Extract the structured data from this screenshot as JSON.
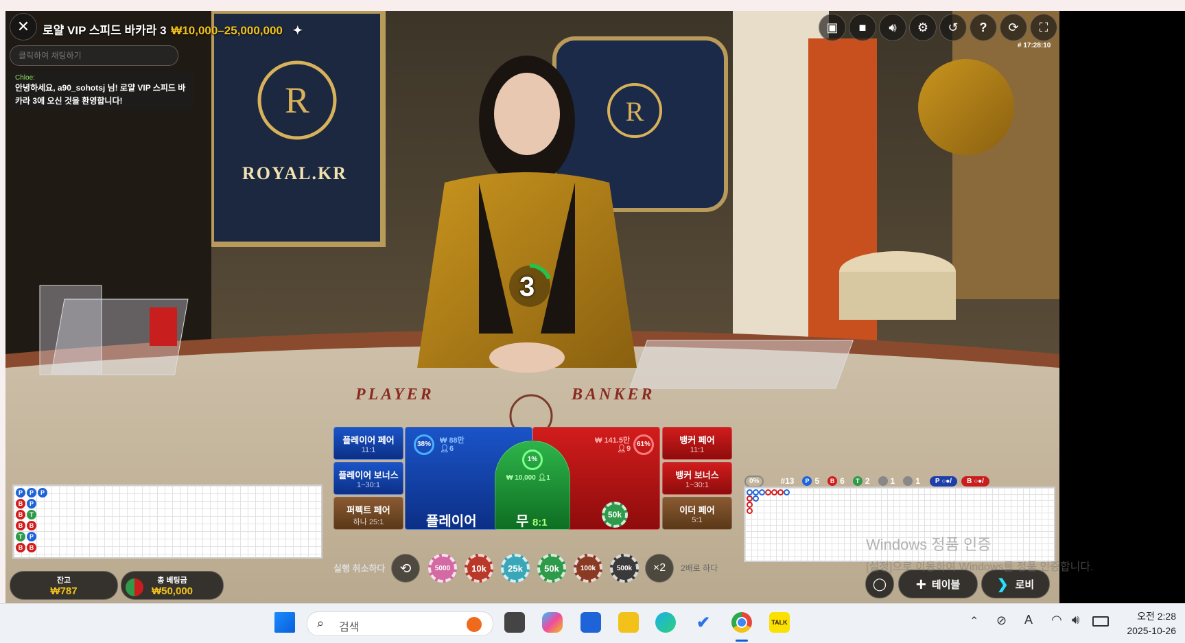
{
  "window": {
    "title": "로얄 VIP 스피드 바카라 3",
    "limits": "₩10,000–25,000,000",
    "round_time": "# 17:28:10"
  },
  "chat": {
    "placeholder": "클릭하여 채팅하기",
    "author": "Chloe:",
    "message": "안녕하세요, a90_sohotsj 님! 로얄 VIP 스피드 바카라 3에 오신 것을 환영합니다!"
  },
  "scene": {
    "sign": "ROYAL.KR",
    "player_label": "PLAYER",
    "banker_label": "BANKER",
    "countdown": "3"
  },
  "toolbar_icons": [
    "chat-icon",
    "video-icon",
    "sound-icon",
    "settings-icon",
    "history-icon",
    "help-icon",
    "refresh-icon",
    "fullscreen-icon"
  ],
  "side_bets": {
    "player_pair": {
      "label": "플레이어 페어",
      "odds": "11:1"
    },
    "player_bonus": {
      "label": "플레이어 보너스",
      "odds": "1~30:1"
    },
    "perfect_pair": {
      "label": "퍼펙트 페어",
      "odds": "하나 25:1"
    },
    "banker_pair": {
      "label": "뱅커 페어",
      "odds": "11:1"
    },
    "banker_bonus": {
      "label": "뱅커 보너스",
      "odds": "1~30:1"
    },
    "either_pair": {
      "label": "이더 페어",
      "odds": "5:1"
    }
  },
  "main_bets": {
    "player": {
      "label": "플레이어",
      "percent": "38%",
      "amount": "₩ 88만",
      "players": "6"
    },
    "tie": {
      "label": "무",
      "odds": "8:1",
      "percent": "1%",
      "amount": "₩ 10,000",
      "players": "1"
    },
    "banker": {
      "label": "",
      "percent": "61%",
      "amount": "₩ 141.5만",
      "players": "9",
      "chip": "50k"
    }
  },
  "chips": {
    "undo_label": "실행 취소하다",
    "items": [
      {
        "label": "5000",
        "color": "#d46aa4"
      },
      {
        "label": "10k",
        "color": "#b8382a"
      },
      {
        "label": "25k",
        "color": "#3aa7b8"
      },
      {
        "label": "50k",
        "color": "#2e9a4a"
      },
      {
        "label": "100k",
        "color": "#8a3a22"
      },
      {
        "label": "500k",
        "color": "#3a3a3a"
      }
    ],
    "double_label": "×2",
    "double_text": "2배로 하다"
  },
  "balance": {
    "label": "잔고",
    "value": "₩787"
  },
  "total_bet": {
    "label": "총 베팅금",
    "value": "₩50,000"
  },
  "stats": {
    "percent": "0%",
    "round": "#13",
    "player": "5",
    "banker": "6",
    "tie": "2",
    "player_pair": "1",
    "banker_pair": "1",
    "p_letter": "P",
    "b_letter": "B",
    "t_letter": "T"
  },
  "bead_road": [
    {
      "col": 0,
      "row": 0,
      "v": "P"
    },
    {
      "col": 1,
      "row": 0,
      "v": "P"
    },
    {
      "col": 2,
      "row": 0,
      "v": "P"
    },
    {
      "col": 0,
      "row": 1,
      "v": "B"
    },
    {
      "col": 1,
      "row": 1,
      "v": "P"
    },
    {
      "col": 0,
      "row": 2,
      "v": "B"
    },
    {
      "col": 1,
      "row": 2,
      "v": "T"
    },
    {
      "col": 0,
      "row": 3,
      "v": "B"
    },
    {
      "col": 1,
      "row": 3,
      "v": "B"
    },
    {
      "col": 0,
      "row": 4,
      "v": "T"
    },
    {
      "col": 1,
      "row": 4,
      "v": "P"
    },
    {
      "col": 0,
      "row": 5,
      "v": "B"
    },
    {
      "col": 1,
      "row": 5,
      "v": "B"
    }
  ],
  "actions": {
    "table_label": "테이블",
    "lobby_label": "로비"
  },
  "watermark": {
    "line1": "Windows 정품 인증",
    "line2": "[설정]으로 이동하여 Windows를 정품 인증합니다."
  },
  "taskbar": {
    "search_placeholder": "검색",
    "time": "오전 2:28",
    "date": "2025-10-26",
    "apps": [
      "windows-start-icon",
      "task-view-icon",
      "copilot-icon",
      "store-icon",
      "file-explorer-icon",
      "edge-icon",
      "todo-icon",
      "chrome-icon",
      "kakaotalk-icon"
    ],
    "kakao_label": "TALK"
  }
}
